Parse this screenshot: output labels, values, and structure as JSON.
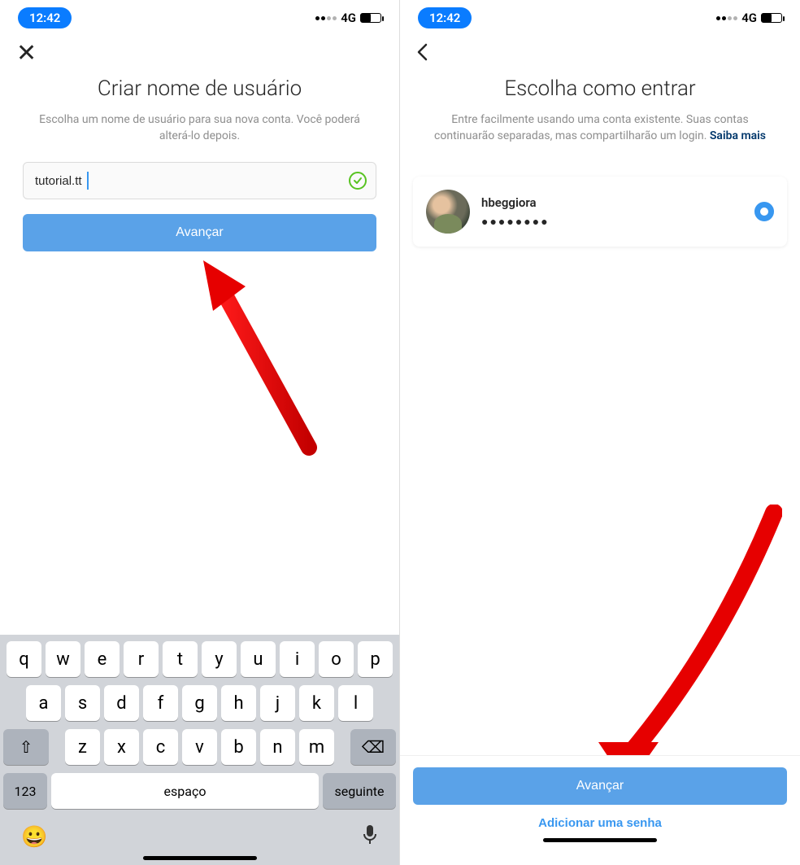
{
  "status": {
    "time": "12:42",
    "network": "4G"
  },
  "left": {
    "title": "Criar nome de usuário",
    "subtitle": "Escolha um nome de usuário para sua nova conta. Você poderá alterá-lo depois.",
    "username_value": "tutorial.tt",
    "button_label": "Avançar"
  },
  "right": {
    "title": "Escolha como entrar",
    "subtitle_prefix": "Entre facilmente usando uma conta existente. Suas contas continuarão separadas, mas compartilharão um login. ",
    "learn_more": "Saiba mais",
    "account_name": "hbeggiora",
    "account_password_masked": "●●●●●●●●",
    "button_label": "Avançar",
    "add_password_label": "Adicionar uma senha"
  },
  "keyboard": {
    "row1": [
      "q",
      "w",
      "e",
      "r",
      "t",
      "y",
      "u",
      "i",
      "o",
      "p"
    ],
    "row2": [
      "a",
      "s",
      "d",
      "f",
      "g",
      "h",
      "j",
      "k",
      "l"
    ],
    "row3": [
      "z",
      "x",
      "c",
      "v",
      "b",
      "n",
      "m"
    ],
    "num_label": "123",
    "space_label": "espaço",
    "next_label": "seguinte"
  }
}
